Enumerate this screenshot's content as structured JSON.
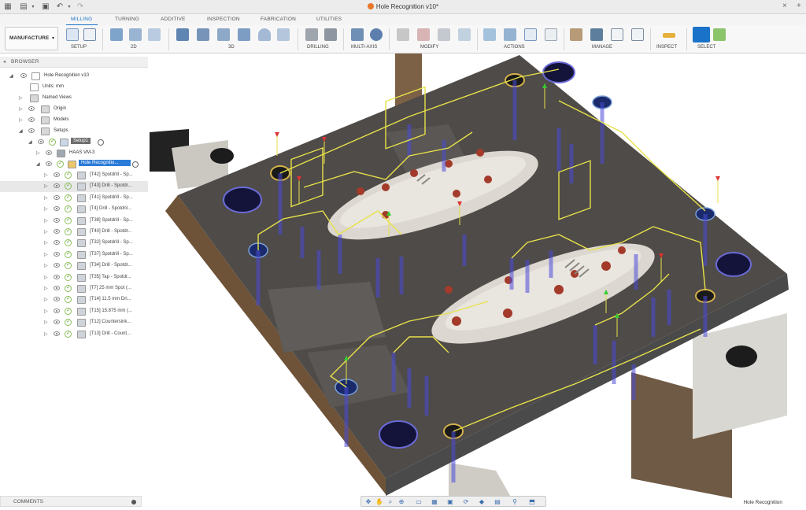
{
  "window": {
    "title": "Hole Recognition v10*"
  },
  "tabs": [
    "MILLING",
    "TURNING",
    "ADDITIVE",
    "INSPECTION",
    "FABRICATION",
    "UTILITIES"
  ],
  "active_tab": "MILLING",
  "workspace": "MANUFACTURE",
  "ribbon_groups": [
    "SETUP",
    "2D",
    "3D",
    "DRILLING",
    "MULTI-AXIS",
    "MODIFY",
    "ACTIONS",
    "MANAGE",
    "INSPECT",
    "SELECT"
  ],
  "browser": {
    "header": "BROWSER",
    "root": "Hole Recognition v10",
    "units": "Units: mm",
    "named_views": "Named Views",
    "origin": "Origin",
    "models": "Models",
    "setups": "Setups",
    "setup": "Setup1",
    "machine": "HAAS VM-3",
    "folder": "Hole Recognitio...",
    "operations": [
      "[T42] Spotdrill - Sp...",
      "[T43] Drill - Spotdr...",
      "[T41] Spotdrill - Sp...",
      "[T4] Drill - Spotdril...",
      "[T38] Spotdrill - Sp...",
      "[T40] Drill - Spotdr...",
      "[T32] Spotdrill - Sp...",
      "[T37] Spotdrill - Sp...",
      "[T34] Drill - Spotdr...",
      "[T35] Tap - Spotdr...",
      "[T7] 25 mm Spot (...",
      "[T14] 11.5 mm Dri...",
      "[T15] 15.875 mm (...",
      "[T12] Countersink...",
      "[T13] Drill - Count..."
    ]
  },
  "comments_label": "COMMENTS",
  "status": "Hole Recognition",
  "colors": {
    "accent": "#1a73c8",
    "toolpath": "#e8e24a",
    "hole_tool": "#3c3cc8",
    "part": "#4a4744",
    "highlight": "#2b7bd8"
  },
  "icons": [
    "grid-icon",
    "file-icon",
    "save-icon",
    "undo-icon",
    "redo-icon",
    "orbit-icon",
    "pan-icon",
    "zoom-icon",
    "fit-icon",
    "display-icon",
    "grid-settings-icon",
    "viewport-icon",
    "camera-icon",
    "env-icon",
    "effects-icon",
    "object-vis-icon"
  ]
}
